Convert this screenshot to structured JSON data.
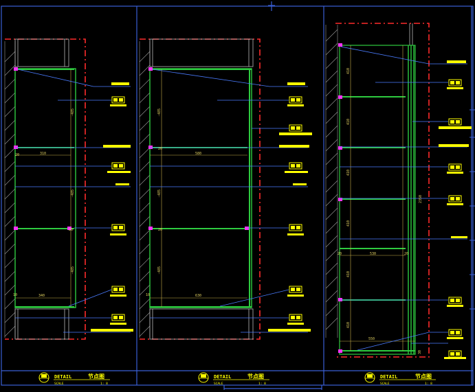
{
  "colors": {
    "background": "#000000",
    "frame": "#3a5fd6",
    "wall_dash": "#ff2a2a",
    "shelf": "#2ecc40",
    "leader": "#4a7cff",
    "tag": "#ffff00",
    "dim": "#c8b04a",
    "magenta": "#ff33ff",
    "hatch": "#9a9a9a"
  },
  "panels": [
    {
      "id": "detail-1",
      "dims": [
        "310",
        "340",
        "-485",
        "-485",
        "-485",
        "20",
        "20",
        "10"
      ],
      "title_en": "DETAIL",
      "title_cn": "节点图",
      "scale_label": "SCALE",
      "scale_value": "1: 8"
    },
    {
      "id": "detail-2",
      "dims": [
        "580",
        "630",
        "-485",
        "-485",
        "-485",
        "20",
        "20",
        "10"
      ],
      "title_en": "DETAIL",
      "title_cn": "节点图",
      "scale_label": "SCALE",
      "scale_value": "1: 8"
    },
    {
      "id": "detail-3",
      "dims": [
        "530",
        "550",
        "410",
        "410",
        "410",
        "410",
        "410",
        "410",
        "2350",
        "20",
        "20",
        "30"
      ],
      "title_en": "DETAIL",
      "title_cn": "节点图",
      "scale_label": "SCALE",
      "scale_value": "1: 8"
    }
  ]
}
